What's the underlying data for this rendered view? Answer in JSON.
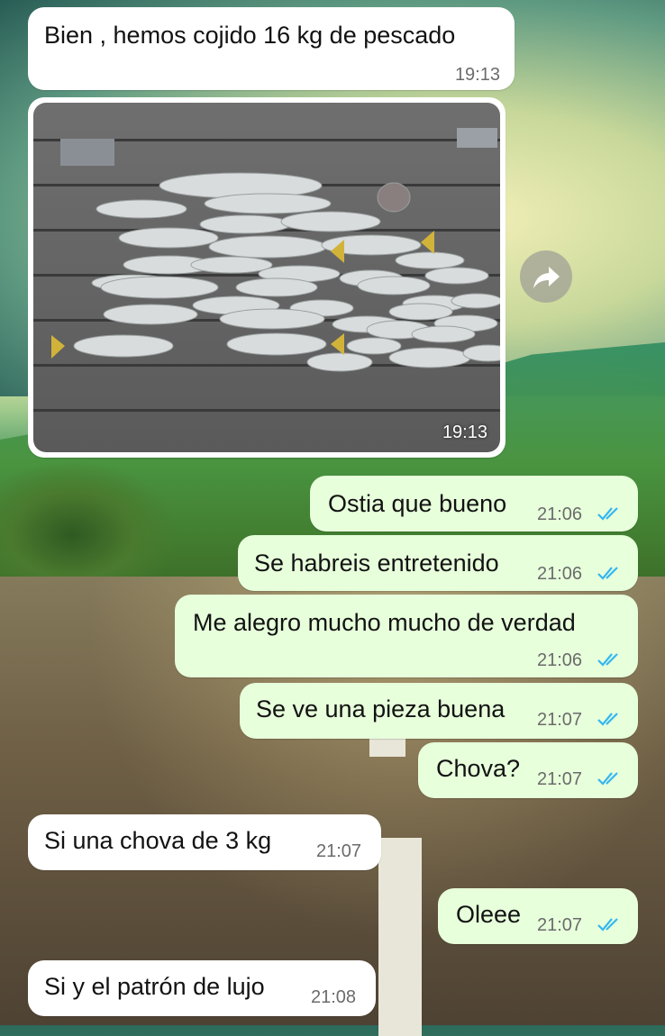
{
  "messages": [
    {
      "text": "Bien , hemos cojido 16 kg de pescado",
      "time": "19:13"
    },
    {
      "photo_time": "19:13"
    },
    {
      "text": "Ostia que bueno",
      "time": "21:06"
    },
    {
      "text": "Se habreis entretenido",
      "time": "21:06"
    },
    {
      "text": "Me alegro mucho mucho de verdad",
      "time": "21:06"
    },
    {
      "text": "Se ve una pieza buena",
      "time": "21:07"
    },
    {
      "text": "Chova?",
      "time": "21:07"
    },
    {
      "text": "Si una chova de 3 kg",
      "time": "21:07"
    },
    {
      "text": "Oleee",
      "time": "21:07"
    },
    {
      "text": "Si y el patrón de lujo",
      "time": "21:08"
    }
  ],
  "colors": {
    "incoming": "#ffffff",
    "outgoing": "#e7ffdb",
    "read_ticks": "#34b7f1"
  },
  "icons": {
    "forward": "forward-arrow-icon",
    "read": "double-check-icon"
  }
}
